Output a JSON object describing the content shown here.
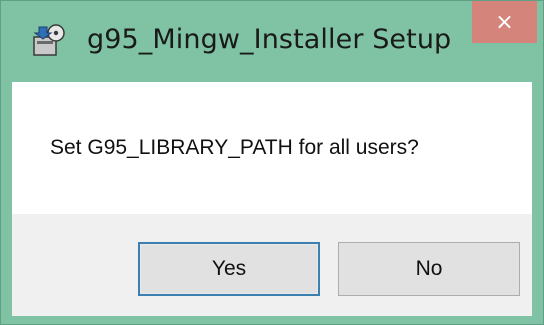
{
  "window": {
    "title": "g95_Mingw_Installer Setup",
    "close_glyph": "×",
    "icon": "installer-app-icon"
  },
  "dialog": {
    "message": "Set G95_LIBRARY_PATH for all users?",
    "buttons": {
      "yes_label": "Yes",
      "no_label": "No"
    }
  },
  "colors": {
    "frame": "#7fc3a4",
    "close_button": "#d4847b",
    "default_button_border": "#3c7fb1"
  }
}
